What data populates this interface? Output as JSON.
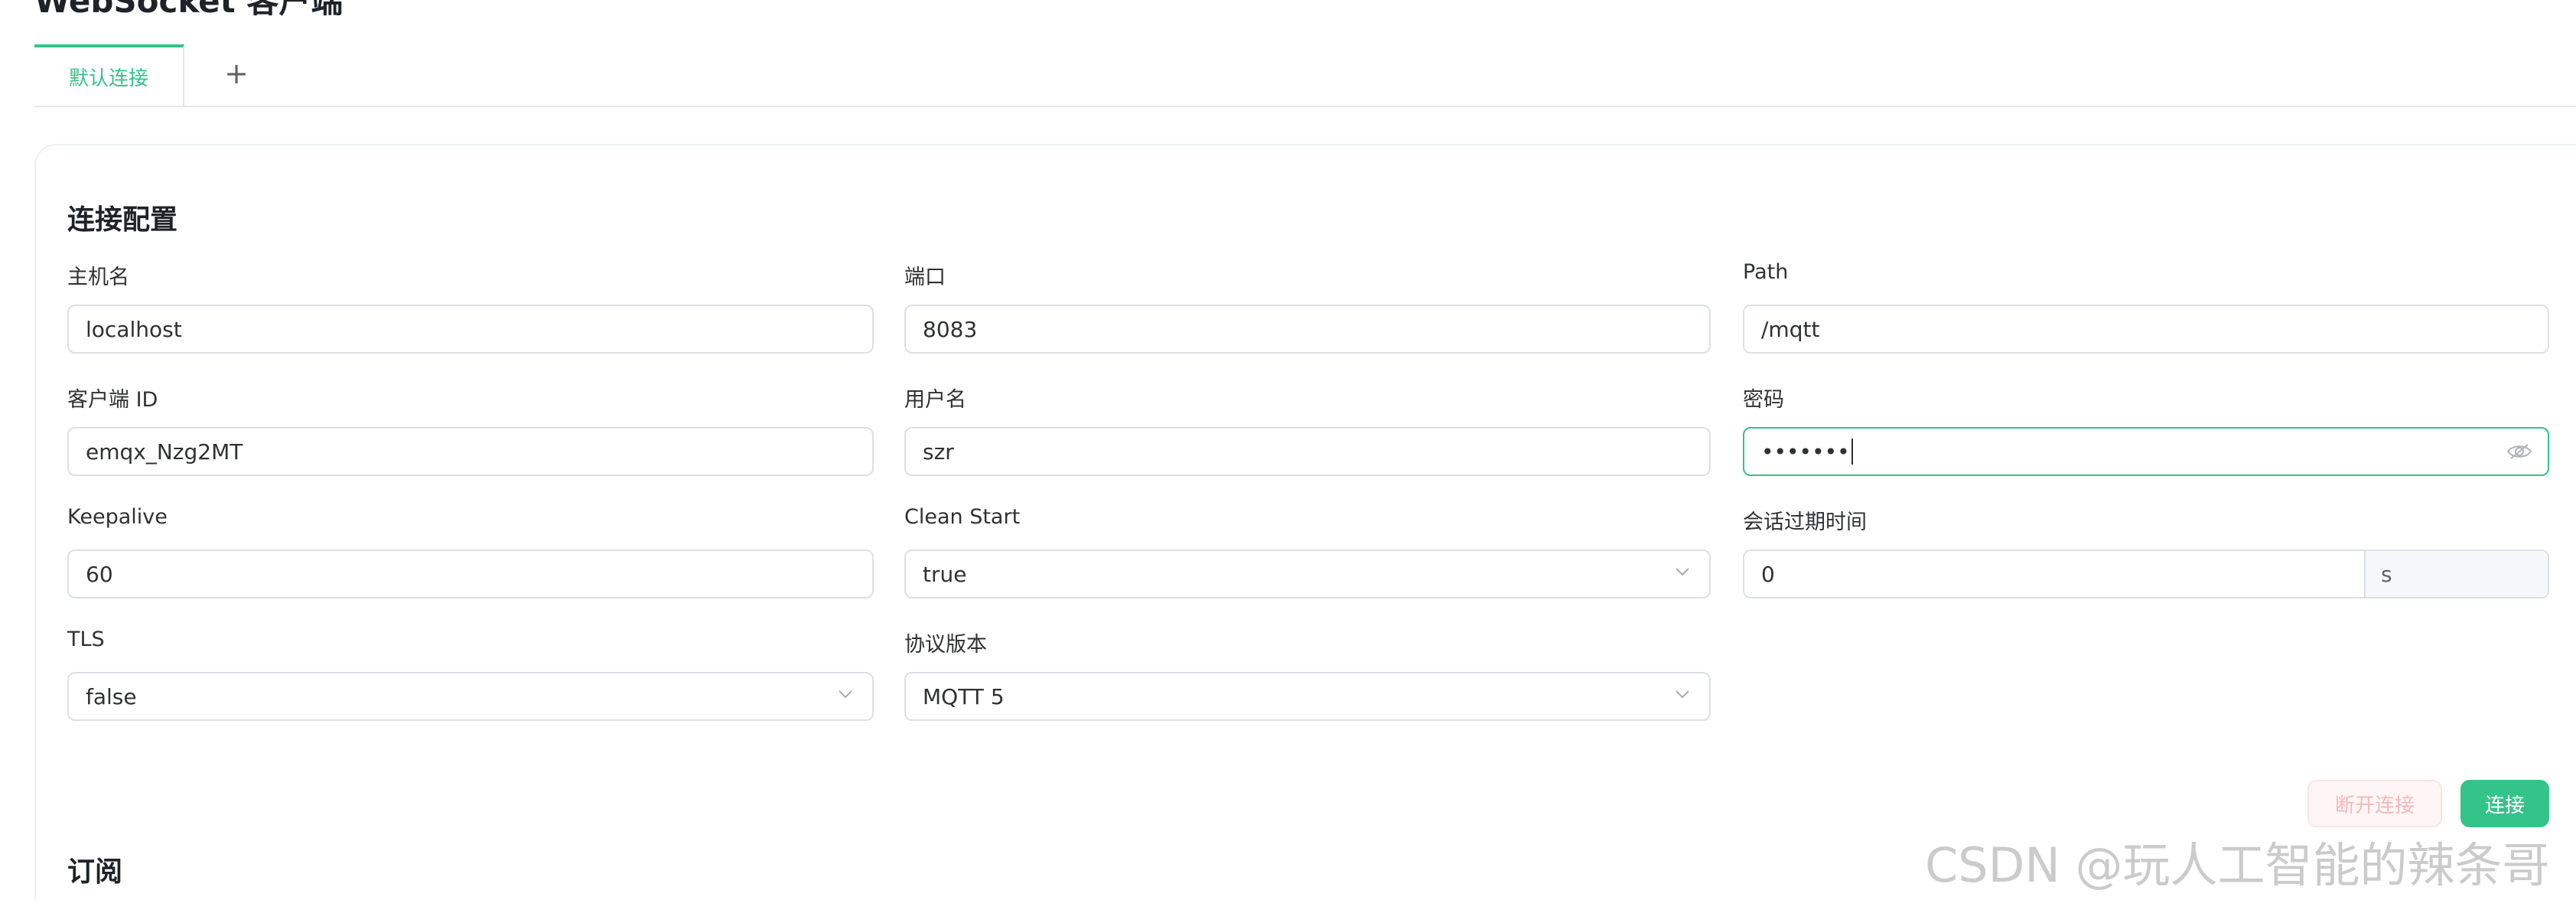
{
  "page": {
    "title": "WebSocket 客户端"
  },
  "tabs": {
    "items": [
      {
        "label": "默认连接",
        "active": true
      }
    ],
    "add_label": "+"
  },
  "connection_config": {
    "section_title": "连接配置",
    "fields": {
      "host": {
        "label": "主机名",
        "value": "localhost"
      },
      "port": {
        "label": "端口",
        "value": "8083"
      },
      "path": {
        "label": "Path",
        "value": "/mqtt"
      },
      "client_id": {
        "label": "客户端 ID",
        "value": "emqx_Nzg2MT"
      },
      "username": {
        "label": "用户名",
        "value": "szr"
      },
      "password": {
        "label": "密码",
        "value": "•••••••"
      },
      "keepalive": {
        "label": "Keepalive",
        "value": "60"
      },
      "clean_start": {
        "label": "Clean Start",
        "value": "true"
      },
      "session_expiry": {
        "label": "会话过期时间",
        "value": "0",
        "suffix": "s"
      },
      "tls": {
        "label": "TLS",
        "value": "false"
      },
      "protocol_version": {
        "label": "协议版本",
        "value": "MQTT 5"
      }
    },
    "buttons": {
      "disconnect_label": "断开连接",
      "connect_label": "连接"
    }
  },
  "subscribe": {
    "section_title": "订阅"
  },
  "watermark": {
    "text": "CSDN @玩人工智能的辣条哥"
  },
  "colors": {
    "accent": "#34c388",
    "border": "#dcdfe6",
    "disabled_danger_text": "#f5b8b8"
  },
  "icons": {
    "select_arrow": "chevron-down-icon",
    "password_toggle": "eye-icon",
    "add_tab": "plus-icon"
  }
}
